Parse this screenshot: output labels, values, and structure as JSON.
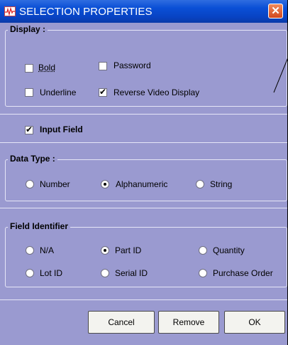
{
  "window": {
    "title": "SELECTION PROPERTIES",
    "close_glyph": "✕",
    "app_icon": "waveform-icon",
    "colors": {
      "titlebar": "#0a4fd6",
      "client": "#9a9ad0",
      "close": "#d2471e"
    }
  },
  "display": {
    "legend": "Display :",
    "bold": {
      "label": "Bold",
      "checked": false
    },
    "password": {
      "label": "Password",
      "checked": false
    },
    "underline": {
      "label": "Underline",
      "checked": false
    },
    "reverse_video": {
      "label": "Reverse Video Display",
      "checked": true
    }
  },
  "input_field": {
    "label": "Input Field",
    "checked": true
  },
  "data_type": {
    "legend": "Data Type :",
    "options": [
      "Number",
      "Alphanumeric",
      "String"
    ],
    "selected": "Alphanumeric"
  },
  "field_identifier": {
    "legend": "Field Identifier",
    "options": [
      "N/A",
      "Part ID",
      "Quantity",
      "Lot ID",
      "Serial ID",
      "Purchase Order"
    ],
    "selected": "Part ID"
  },
  "buttons": {
    "cancel": "Cancel",
    "remove": "Remove",
    "ok": "OK"
  }
}
